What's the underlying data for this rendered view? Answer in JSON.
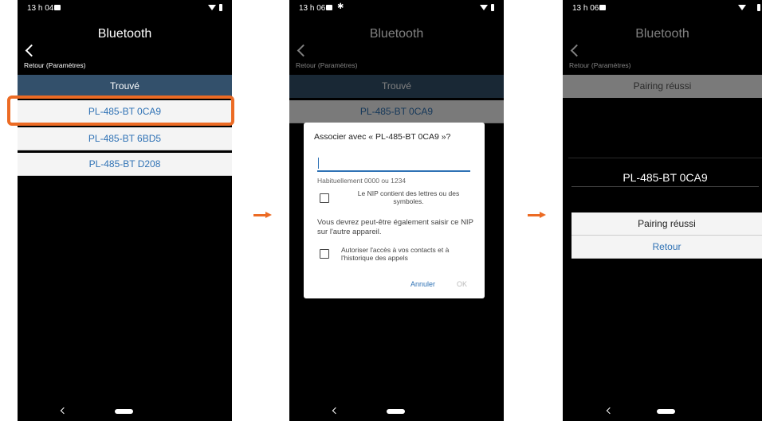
{
  "screens": [
    {
      "status_time": "13 h 04",
      "title": "Bluetooth",
      "back_label": "Retour (Paramètres)",
      "section_header": "Trouvé",
      "devices": [
        "PL-485-BT 0CA9",
        "PL-485-BT 6BD5",
        "PL-485-BT D208"
      ]
    },
    {
      "status_time": "13 h 06",
      "status_bt": "✱",
      "title": "Bluetooth",
      "back_label": "Retour (Paramètres)",
      "section_header": "Trouvé",
      "device_behind": "PL-485-BT 0CA9",
      "dialog": {
        "title": "Associer avec « PL-485-BT 0CA9 »?",
        "pin_value": "",
        "hint": "Habituellement 0000 ou 1234",
        "checkbox_letters": "Le NIP contient des lettres ou des symboles.",
        "info": "Vous devrez peut-être également saisir ce NIP sur l'autre appareil.",
        "checkbox_contacts": "Autoriser l'accès à vos contacts et à l'historique des appels",
        "cancel": "Annuler",
        "ok": "OK"
      }
    },
    {
      "status_time": "13 h 06",
      "title": "Bluetooth",
      "back_label": "Retour (Paramètres)",
      "section_header": "Pairing réussi",
      "result": {
        "title": "PL-485-BT 0CA9",
        "message": "Pairing réussi",
        "back_button": "Retour"
      }
    }
  ],
  "colors": {
    "accent_orange": "#ec6b24",
    "link_blue": "#2f72b5",
    "header_blue": "#33506b"
  },
  "icons": [
    "image-icon",
    "bluetooth-icon",
    "wifi-icon",
    "battery-icon",
    "back-chevron-icon",
    "nav-back-icon",
    "nav-home-icon",
    "arrow-right-icon"
  ]
}
